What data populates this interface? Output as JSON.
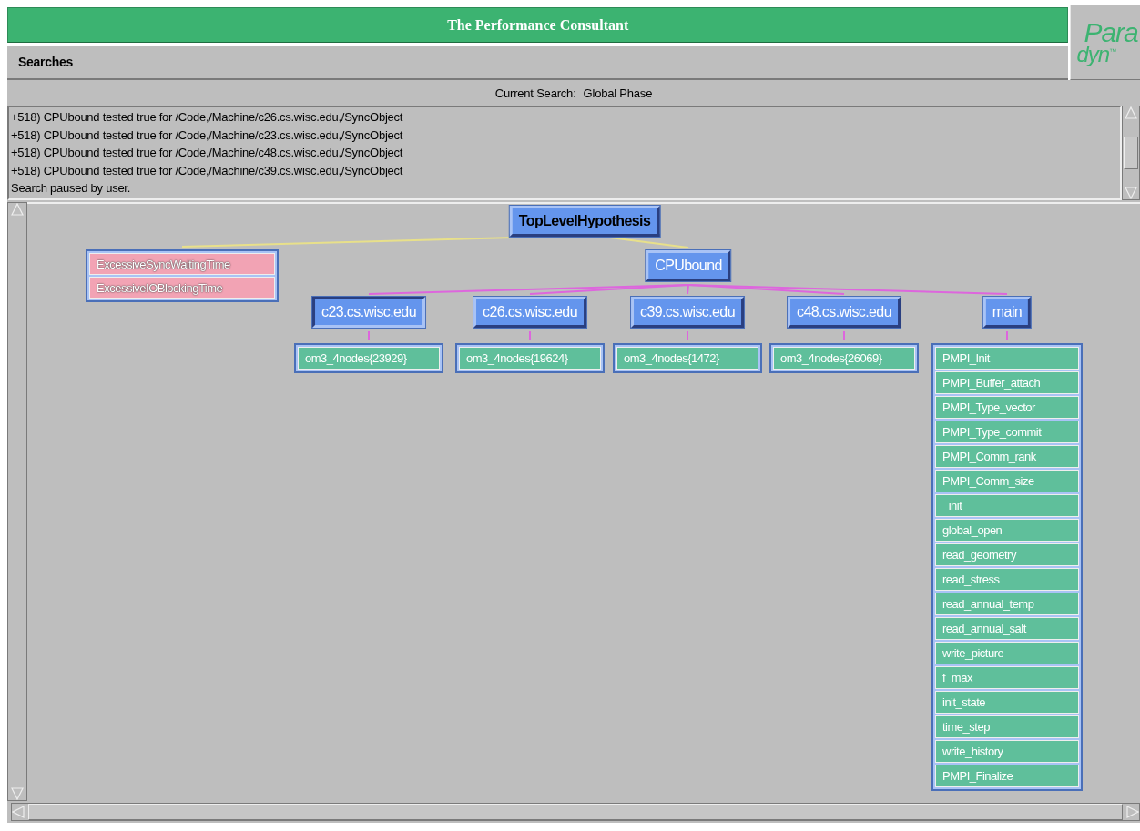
{
  "window": {
    "title": "The Performance Consultant"
  },
  "logo": {
    "line_1": "Para",
    "line_2": "dyn",
    "mark": "™"
  },
  "menu": {
    "items": [
      {
        "label": "Searches"
      }
    ]
  },
  "current_search": {
    "label": "Current Search:",
    "value": "Global Phase"
  },
  "log": {
    "lines": [
      "+518) CPUbound tested true for /Code,/Machine/c26.cs.wisc.edu,/SyncObject",
      "+518) CPUbound tested true for /Code,/Machine/c23.cs.wisc.edu,/SyncObject",
      "+518) CPUbound tested true for /Code,/Machine/c48.cs.wisc.edu,/SyncObject",
      "+518) CPUbound tested true for /Code,/Machine/c39.cs.wisc.edu,/SyncObject",
      "Search paused by user."
    ]
  },
  "tree": {
    "label": "TopLevelHypothesis",
    "color": "#6495ed",
    "selected": false,
    "children": [
      {
        "label": "ExcessiveSyncWaitingTime",
        "color": "#f2a3b4",
        "selected": false
      },
      {
        "label": "ExcessiveIOBlockingTime",
        "color": "#f2a3b4",
        "selected": false
      },
      {
        "label": "CPUbound",
        "color": "#6495ed",
        "selected": false,
        "children": [
          {
            "label": "c23.cs.wisc.edu",
            "color": "#6495ed",
            "selected": true,
            "children": [
              {
                "label": "om3_4nodes{23929}",
                "color": "#5fbf9b",
                "selected": false
              }
            ]
          },
          {
            "label": "c26.cs.wisc.edu",
            "color": "#6495ed",
            "selected": false,
            "children": [
              {
                "label": "om3_4nodes{19624}",
                "color": "#5fbf9b",
                "selected": false
              }
            ]
          },
          {
            "label": "c39.cs.wisc.edu",
            "color": "#6495ed",
            "selected": false,
            "children": [
              {
                "label": "om3_4nodes{1472}",
                "color": "#5fbf9b",
                "selected": false
              }
            ]
          },
          {
            "label": "c48.cs.wisc.edu",
            "color": "#6495ed",
            "selected": false,
            "children": [
              {
                "label": "om3_4nodes{26069}",
                "color": "#5fbf9b",
                "selected": false
              }
            ]
          },
          {
            "label": "main",
            "color": "#6495ed",
            "selected": false,
            "children": [
              {
                "label": "PMPI_Init",
                "color": "#5fbf9b",
                "selected": false
              },
              {
                "label": "PMPI_Buffer_attach",
                "color": "#5fbf9b",
                "selected": false
              },
              {
                "label": "PMPI_Type_vector",
                "color": "#5fbf9b",
                "selected": false
              },
              {
                "label": "PMPI_Type_commit",
                "color": "#5fbf9b",
                "selected": false
              },
              {
                "label": "PMPI_Comm_rank",
                "color": "#5fbf9b",
                "selected": false
              },
              {
                "label": "PMPI_Comm_size",
                "color": "#5fbf9b",
                "selected": false
              },
              {
                "label": "_init",
                "color": "#5fbf9b",
                "selected": false
              },
              {
                "label": "global_open",
                "color": "#5fbf9b",
                "selected": false
              },
              {
                "label": "read_geometry",
                "color": "#5fbf9b",
                "selected": false
              },
              {
                "label": "read_stress",
                "color": "#5fbf9b",
                "selected": false
              },
              {
                "label": "read_annual_temp",
                "color": "#5fbf9b",
                "selected": false
              },
              {
                "label": "read_annual_salt",
                "color": "#5fbf9b",
                "selected": false
              },
              {
                "label": "write_picture",
                "color": "#5fbf9b",
                "selected": false
              },
              {
                "label": "f_max",
                "color": "#5fbf9b",
                "selected": false
              },
              {
                "label": "init_state",
                "color": "#5fbf9b",
                "selected": false
              },
              {
                "label": "time_step",
                "color": "#5fbf9b",
                "selected": false
              },
              {
                "label": "write_history",
                "color": "#5fbf9b",
                "selected": false
              },
              {
                "label": "PMPI_Finalize",
                "color": "#5fbf9b",
                "selected": false
              }
            ]
          }
        ]
      }
    ]
  }
}
